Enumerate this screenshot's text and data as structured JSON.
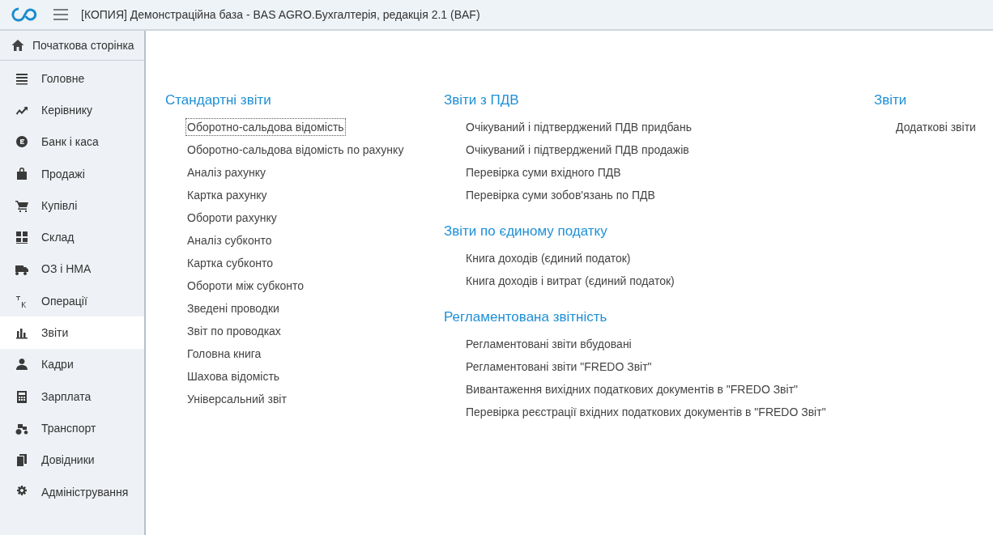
{
  "window": {
    "title": "[КОПИЯ] Демонстраційна база - BAS AGRO.Бухгалтерія, редакція 2.1  (BAF)"
  },
  "home": {
    "label": "Початкова сторінка"
  },
  "sidebar": {
    "items": [
      {
        "label": "Головне",
        "selected": false
      },
      {
        "label": "Керівнику",
        "selected": false
      },
      {
        "label": "Банк і каса",
        "selected": false
      },
      {
        "label": "Продажі",
        "selected": false
      },
      {
        "label": "Купівлі",
        "selected": false
      },
      {
        "label": "Склад",
        "selected": false
      },
      {
        "label": "ОЗ і НМА",
        "selected": false
      },
      {
        "label": "Операції",
        "selected": false
      },
      {
        "label": "Звіти",
        "selected": true
      },
      {
        "label": "Кадри",
        "selected": false
      },
      {
        "label": "Зарплата",
        "selected": false
      },
      {
        "label": "Транспорт",
        "selected": false
      },
      {
        "label": "Довідники",
        "selected": false
      },
      {
        "label": "Адміністрування",
        "selected": false
      }
    ]
  },
  "columns": [
    {
      "sections": [
        {
          "title": "Стандартні звіти",
          "items": [
            {
              "label": "Оборотно-сальдова відомість",
              "focused": true
            },
            {
              "label": "Оборотно-сальдова відомість по рахунку",
              "focused": false
            },
            {
              "label": "Аналіз рахунку",
              "focused": false
            },
            {
              "label": "Картка рахунку",
              "focused": false
            },
            {
              "label": "Обороти рахунку",
              "focused": false
            },
            {
              "label": "Аналіз субконто",
              "focused": false
            },
            {
              "label": "Картка субконто",
              "focused": false
            },
            {
              "label": "Обороти між субконто",
              "focused": false
            },
            {
              "label": "Зведені проводки",
              "focused": false
            },
            {
              "label": "Звіт по проводках",
              "focused": false
            },
            {
              "label": "Головна книга",
              "focused": false
            },
            {
              "label": "Шахова відомість",
              "focused": false
            },
            {
              "label": "Універсальний звіт",
              "focused": false
            }
          ]
        }
      ]
    },
    {
      "sections": [
        {
          "title": "Звіти з ПДВ",
          "items": [
            {
              "label": "Очікуваний і підтверджений ПДВ придбань",
              "focused": false
            },
            {
              "label": "Очікуваний і підтверджений ПДВ продажів",
              "focused": false
            },
            {
              "label": "Перевірка суми вхідного ПДВ",
              "focused": false
            },
            {
              "label": "Перевірка суми зобов'язань по ПДВ",
              "focused": false
            }
          ]
        },
        {
          "title": "Звіти по єдиному податку",
          "items": [
            {
              "label": "Книга доходів (єдиний податок)",
              "focused": false
            },
            {
              "label": "Книга доходів і витрат (єдиний податок)",
              "focused": false
            }
          ]
        },
        {
          "title": "Регламентована звітність",
          "items": [
            {
              "label": "Регламентовані звіти вбудовані",
              "focused": false
            },
            {
              "label": "Регламентовані звіти \"FREDO Звіт\"",
              "focused": false
            },
            {
              "label": "Вивантаження вихідних податкових документів в \"FREDO Звіт\"",
              "focused": false
            },
            {
              "label": "Перевірка реєстрації вхідних податкових документів в \"FREDO Звіт\"",
              "focused": false
            }
          ]
        }
      ]
    },
    {
      "sections": [
        {
          "title": "Звіти",
          "items": [
            {
              "label": "Додаткові звіти",
              "focused": false
            }
          ]
        }
      ]
    }
  ]
}
